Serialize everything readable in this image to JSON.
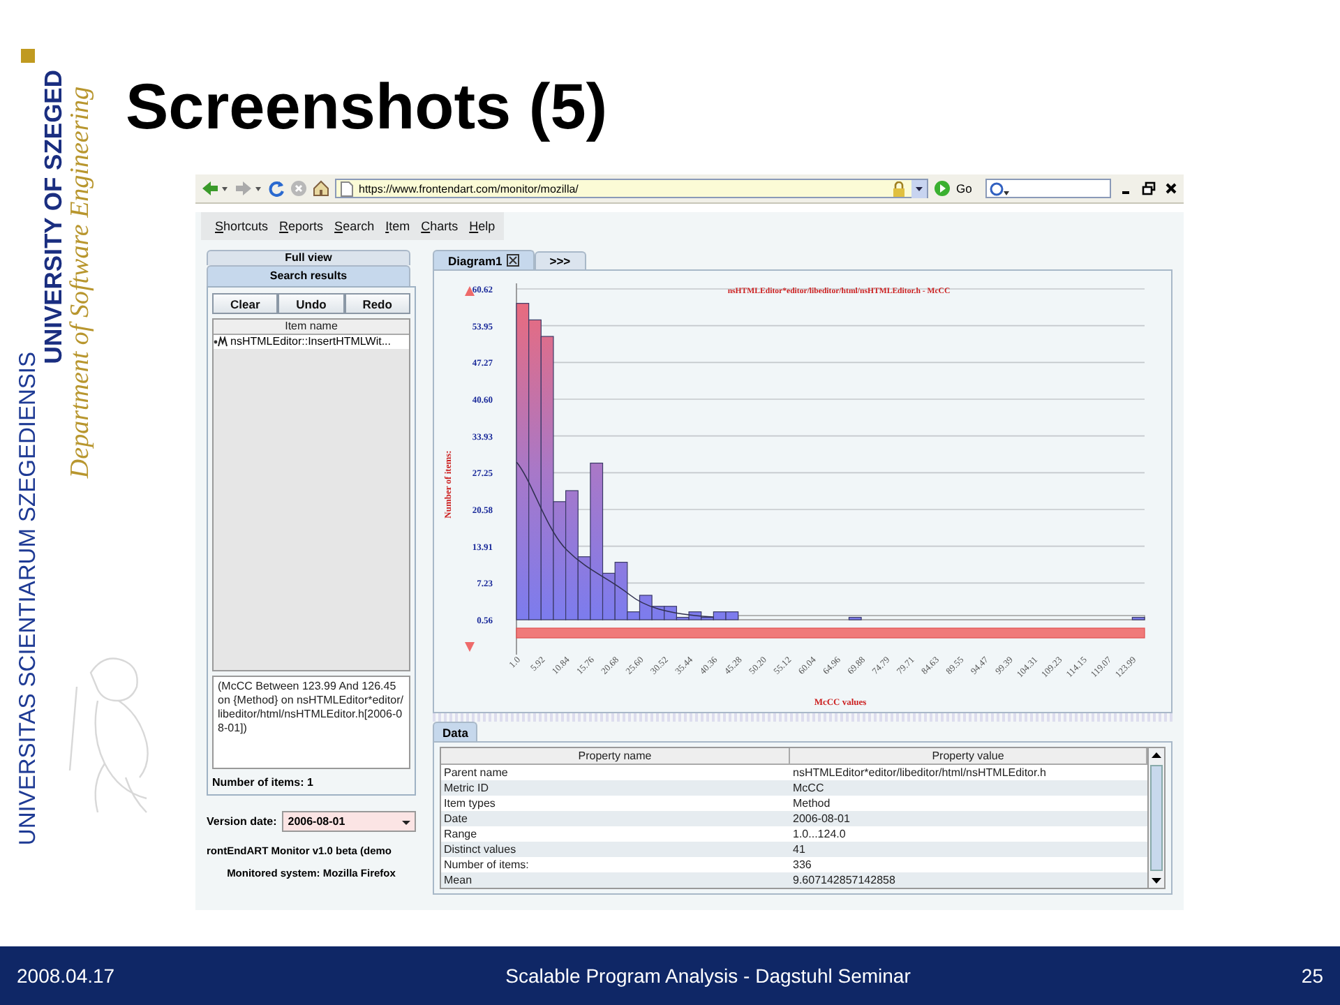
{
  "slide": {
    "title": "Screenshots (5)",
    "logo": {
      "motto": "UNIVERSITAS SCIENTIARUM SZEGEDIENSIS",
      "name": "UNIVERSITY OF SZEGED",
      "department": "Department of Software Engineering"
    },
    "footer": {
      "date": "2008.04.17",
      "caption": "Scalable Program Analysis - Dagstuhl Seminar",
      "page": "25"
    }
  },
  "browser": {
    "address": "https://www.frontendart.com/monitor/mozilla/",
    "go_label": "Go"
  },
  "menu": [
    "Shortcuts",
    "Reports",
    "Search",
    "Item",
    "Charts",
    "Help"
  ],
  "left_panel": {
    "tabs": [
      {
        "label": "Full view",
        "selected": false
      },
      {
        "label": "Search results",
        "selected": true
      }
    ],
    "buttons": [
      "Clear",
      "Undo",
      "Redo"
    ],
    "list": {
      "column": "Item name",
      "rows": [
        "nsHTMLEditor::InsertHTMLWit..."
      ]
    },
    "query": "(McCC Between 123.99 And 126.45 on {Method} on nsHTMLEditor*editor/libeditor/html/nsHTMLEditor.h[2006-08-01])",
    "item_count": "Number of items: 1",
    "version_label": "Version date:",
    "version_value": "2006-08-01",
    "about": "rontEndART Monitor v1.0 beta (demo",
    "monitored": "Monitored system: Mozilla Firefox"
  },
  "diagram": {
    "tabs": [
      {
        "label": "Diagram1",
        "selected": true,
        "closable": true
      },
      {
        "label": ">>>",
        "selected": false,
        "closable": false
      }
    ],
    "chart_data": {
      "type": "bar",
      "title": "nsHTMLEditor*editor/libeditor/html/nsHTMLEditor.h - McCC",
      "xlabel": "McCC values",
      "ylabel": "Number of items:",
      "grid": true,
      "x": [
        2.23,
        4.69,
        7.15,
        9.61,
        12.07,
        14.53,
        16.99,
        19.45,
        21.91,
        24.37,
        26.83,
        29.29,
        31.75,
        34.21,
        36.67,
        39.13,
        41.59,
        44.05,
        68.64,
        125.22
      ],
      "values": [
        58,
        55,
        52,
        22,
        24,
        12,
        29,
        9,
        11,
        2,
        5,
        3,
        3,
        1,
        2,
        1,
        2,
        2,
        1,
        1
      ],
      "xlim": [
        1.0,
        126.45
      ],
      "ylim": [
        0.56,
        60.62
      ],
      "xticks": [
        {
          "value": 1,
          "label": "1.0"
        },
        5.92,
        10.84,
        15.76,
        20.68,
        {
          "value": 25.6,
          "label": "25.60"
        },
        30.52,
        35.44,
        40.36,
        45.28,
        {
          "value": 50.2,
          "label": "50.20"
        },
        55.12,
        60.04,
        64.96,
        69.88,
        74.79,
        79.71,
        84.63,
        89.55,
        94.47,
        99.39,
        104.31,
        109.23,
        114.15,
        119.07,
        123.99
      ],
      "yticks": [
        0.56,
        7.23,
        13.91,
        20.58,
        27.25,
        33.93,
        {
          "value": 40.6,
          "label": "40.60"
        },
        47.27,
        53.95,
        60.62
      ]
    }
  },
  "data_panel": {
    "tabs": [
      {
        "label": "Data",
        "selected": true
      }
    ],
    "columns": [
      "Property name",
      "Property value"
    ],
    "rows": [
      [
        "Parent name",
        "nsHTMLEditor*editor/libeditor/html/nsHTMLEditor.h"
      ],
      [
        "Metric ID",
        "McCC"
      ],
      [
        "Item types",
        "Method"
      ],
      [
        "Date",
        "2006-08-01"
      ],
      [
        "Range",
        "1.0...124.0"
      ],
      [
        "Distinct values",
        "41"
      ],
      [
        "Number of items:",
        "336"
      ],
      [
        "Mean",
        "9.607142857142858"
      ]
    ]
  }
}
